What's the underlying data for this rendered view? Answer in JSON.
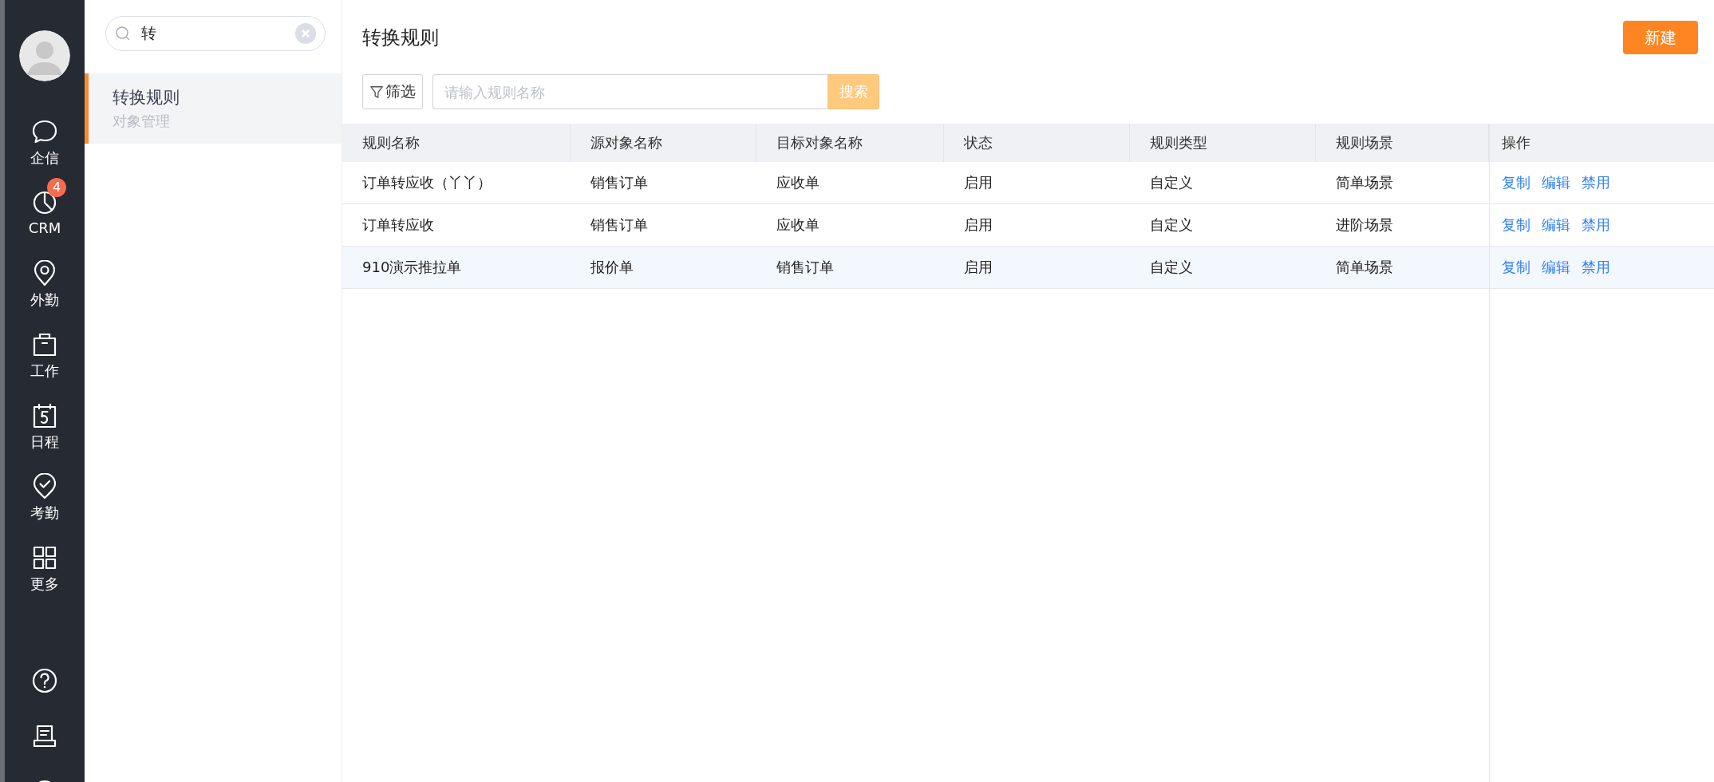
{
  "sidebar": {
    "nav": [
      {
        "label": "企信"
      },
      {
        "label": "CRM",
        "badge": "4"
      },
      {
        "label": "外勤"
      },
      {
        "label": "工作"
      },
      {
        "label": "日程"
      },
      {
        "label": "考勤"
      },
      {
        "label": "更多"
      }
    ]
  },
  "panel": {
    "search": {
      "value": "转"
    },
    "items": [
      {
        "title": "转换规则",
        "subtitle": "对象管理",
        "selected": true
      }
    ]
  },
  "main": {
    "title": "转换规则",
    "new_button": "新建",
    "filter_button": "筛选",
    "search": {
      "placeholder": "请输入规则名称",
      "button": "搜索"
    },
    "table": {
      "columns": [
        "规则名称",
        "源对象名称",
        "目标对象名称",
        "状态",
        "规则类型",
        "规则场景",
        "操作"
      ],
      "rows": [
        {
          "cells": [
            "订单转应收（丫丫）",
            "销售订单",
            "应收单",
            "启用",
            "自定义",
            "简单场景"
          ],
          "actions": [
            "复制",
            "编辑",
            "禁用"
          ],
          "highlighted": false
        },
        {
          "cells": [
            "订单转应收",
            "销售订单",
            "应收单",
            "启用",
            "自定义",
            "进阶场景"
          ],
          "actions": [
            "复制",
            "编辑",
            "禁用"
          ],
          "highlighted": false
        },
        {
          "cells": [
            "910演示推拉单",
            "报价单",
            "销售订单",
            "启用",
            "自定义",
            "简单场景"
          ],
          "actions": [
            "复制",
            "编辑",
            "禁用"
          ],
          "highlighted": true
        }
      ]
    }
  }
}
